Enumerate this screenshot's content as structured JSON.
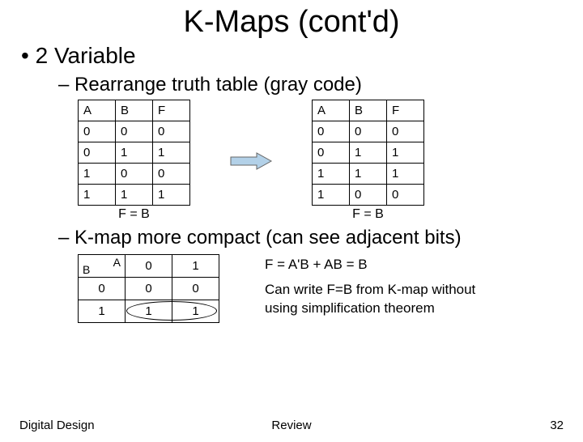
{
  "title": "K-Maps (cont'd)",
  "bullet_main": "2 Variable",
  "sub1": "Rearrange truth table (gray code)",
  "table_left": {
    "headers": [
      "A",
      "B",
      "F"
    ],
    "rows": [
      [
        "0",
        "0",
        "0"
      ],
      [
        "0",
        "1",
        "1"
      ],
      [
        "1",
        "0",
        "0"
      ],
      [
        "1",
        "1",
        "1"
      ]
    ],
    "caption": "F = B"
  },
  "table_right": {
    "headers": [
      "A",
      "B",
      "F"
    ],
    "rows": [
      [
        "0",
        "0",
        "0"
      ],
      [
        "0",
        "1",
        "1"
      ],
      [
        "1",
        "1",
        "1"
      ],
      [
        "1",
        "0",
        "0"
      ]
    ],
    "caption": "F = B"
  },
  "sub2": "K-map more compact (can see adjacent bits)",
  "kmap": {
    "corner_top": "A",
    "corner_bottom": "B",
    "col_headers": [
      "0",
      "1"
    ],
    "row_headers": [
      "0",
      "1"
    ],
    "cells": [
      [
        "0",
        "0"
      ],
      [
        "1",
        "1"
      ]
    ]
  },
  "eq": "F = A'B + AB  = B",
  "note": "Can write F=B from K-map without using simplification theorem",
  "footer": {
    "left": "Digital Design",
    "center": "Review",
    "right": "32"
  },
  "colors": {
    "arrow_fill": "#b3d1e8",
    "arrow_stroke": "#666"
  }
}
